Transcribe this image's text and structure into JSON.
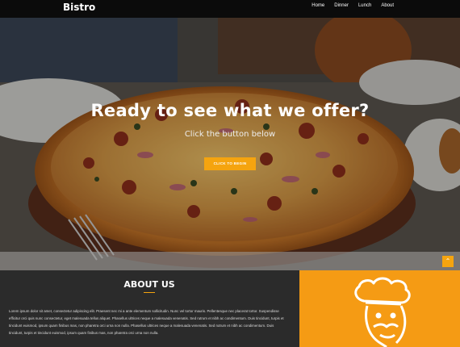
{
  "nav": {
    "brand": "Bistro",
    "links": [
      "Home",
      "Dinner",
      "Lunch",
      "About"
    ]
  },
  "hero": {
    "title": "Ready to see what we offer?",
    "subtitle": "Click the button below",
    "button": "CLICK TO BEGIN"
  },
  "scroll_top": {
    "icon": "chevron-up-icon",
    "glyph": "⌃"
  },
  "about": {
    "title": "ABOUT US",
    "text": "Lorem ipsum dolor sit amet, consectetur adipiscing elit. Praesent nec mi a ante elementum sollicitudin. Nunc vel tortor mauris. Pellentesque nec placerat tortor. Suspendisse efficitur orci quis nunc consectetur, eget malesuada tellus aliquet. Phasellus ultrices neque a malesuada venenatis. Sed rutrum et nibh ac condimentum. Duis tincidunt, turpis et tincidunt euismod, ipsum quam finibus mas, non pharetra orci urna non nulla. Phasellus ultrices neque a malesuada venenatis. Sed rutrum et nibh ac condimentum. Duis tincidunt, turpis et tincidunt euismod, ipsum quam finibus mas, non pharetra orci urna non nulla.",
    "illustration": "chef-icon"
  },
  "colors": {
    "accent": "#f5a40f",
    "nav_bg": "#0b0b0b",
    "about_bg": "#2b2b2b"
  }
}
